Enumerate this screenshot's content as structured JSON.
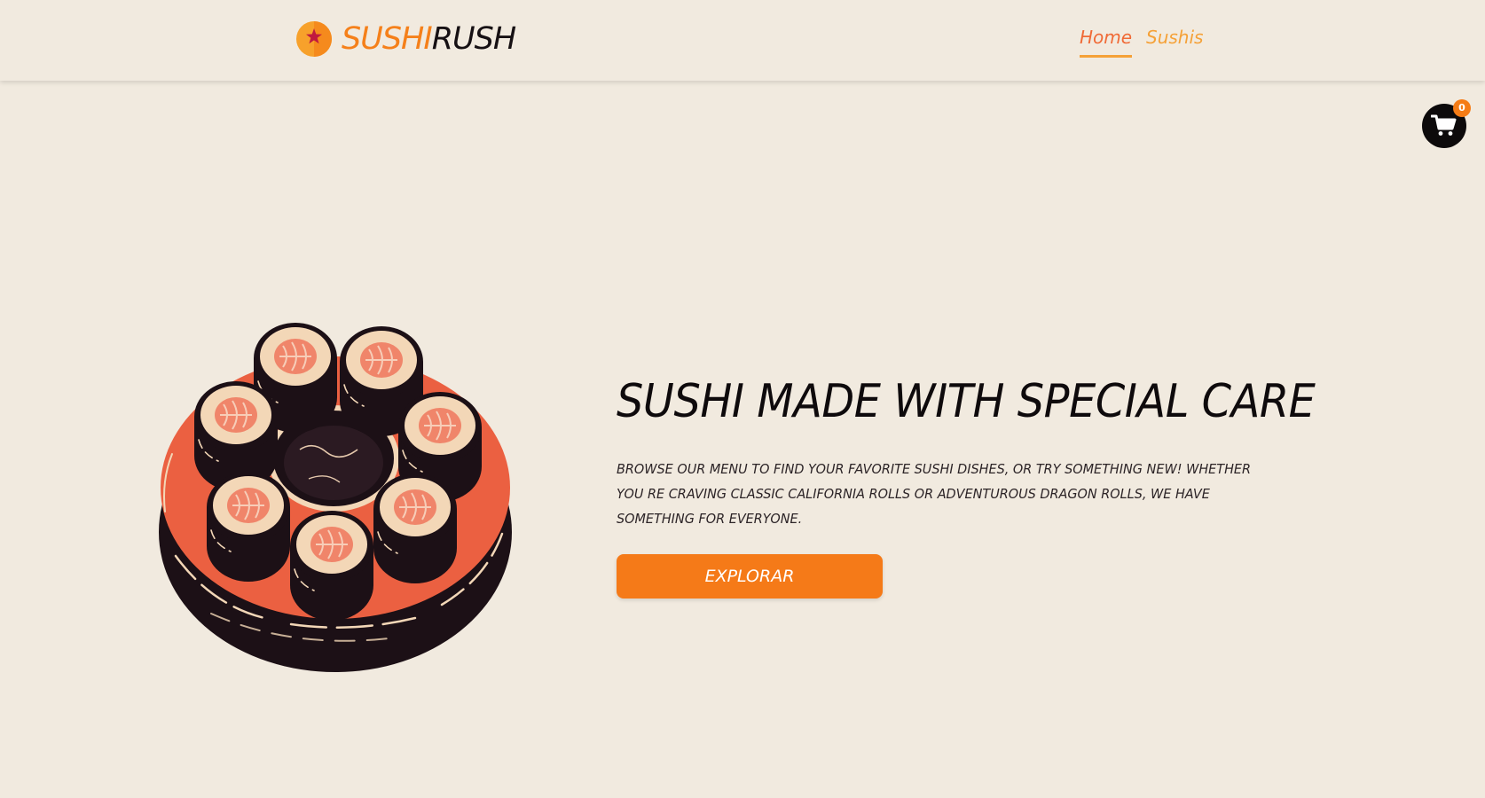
{
  "brand": {
    "name_part1": "SUSHI",
    "name_part2": "RUSH",
    "logo_icon": "star-orb-icon"
  },
  "nav": {
    "items": [
      {
        "label": "Home",
        "active": true
      },
      {
        "label": "Sushis",
        "active": false
      }
    ]
  },
  "cart": {
    "icon": "cart-icon",
    "count": "0"
  },
  "hero": {
    "image_icon": "sushi-platter-illustration",
    "title": "SUSHI MADE WITH SPECIAL CARE",
    "description": "Browse our menu to find your favorite sushi dishes, or try something new! Whether you re craving classic California rolls or adventurous dragon rolls, we have something for everyone.",
    "cta_label": "EXPLORAR"
  },
  "colors": {
    "background": "#f1eadf",
    "accent_orange": "#f57a18",
    "nav_active": "#f06a36",
    "nav_inactive": "#f5a137",
    "text_dark": "#0e0a0c",
    "platter_red": "#eb6041",
    "nori_dark": "#1c1016"
  }
}
